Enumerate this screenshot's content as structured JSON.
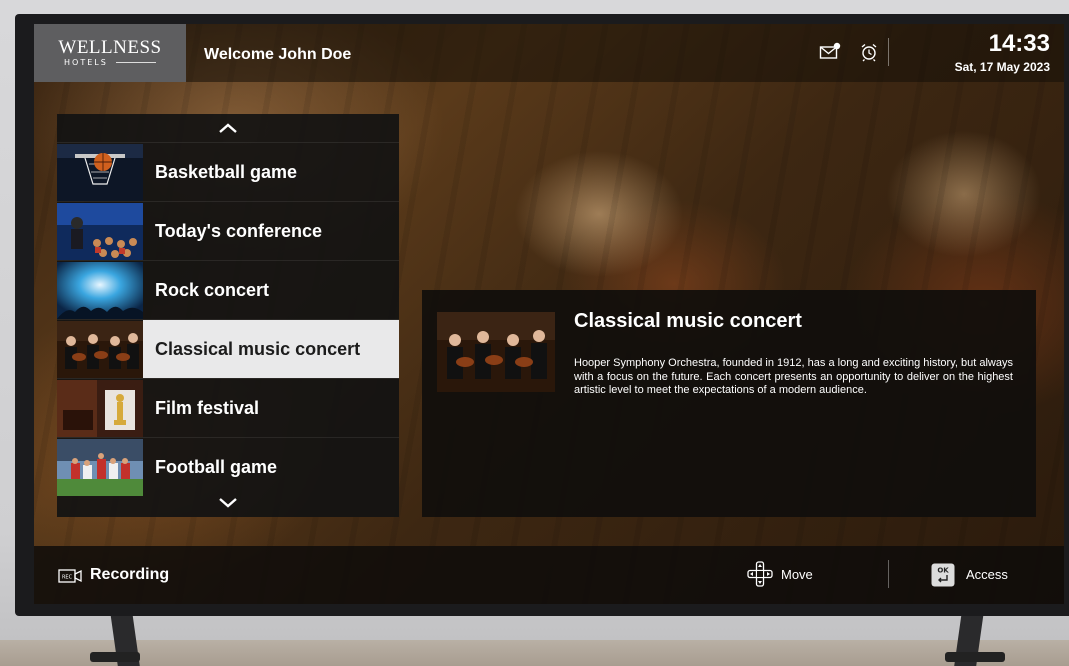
{
  "header": {
    "logo_line1": "WELLNESS",
    "logo_line2": "HOTELS",
    "welcome": "Welcome John Doe",
    "time": "14:33",
    "date": "Sat, 17 May 2023"
  },
  "list": {
    "items": [
      {
        "label": "Basketball game",
        "thumb": "basketball-thumbnail"
      },
      {
        "label": "Today's conference",
        "thumb": "conference-thumbnail"
      },
      {
        "label": "Rock concert",
        "thumb": "rock-concert-thumbnail"
      },
      {
        "label": "Classical music concert",
        "thumb": "classical-concert-thumbnail",
        "selected": true
      },
      {
        "label": "Film festival",
        "thumb": "film-festival-thumbnail"
      },
      {
        "label": "Football game",
        "thumb": "football-thumbnail"
      }
    ]
  },
  "detail": {
    "title": "Classical music concert",
    "description": "Hooper Symphony Orchestra, founded in 1912, has a long and exciting history, but always with a focus on the future. Each concert presents an opportunity to deliver on the highest artistic level to meet the expectations of a modern audience."
  },
  "footer": {
    "recording_label": "Recording",
    "rec_badge": "REC",
    "move_label": "Move",
    "access_label": "Access",
    "ok_badge": "OK"
  },
  "colors": {
    "selected_bg": "#e9e9ea",
    "logo_bg": "#5e5e60",
    "panel_bg": "#121212"
  }
}
